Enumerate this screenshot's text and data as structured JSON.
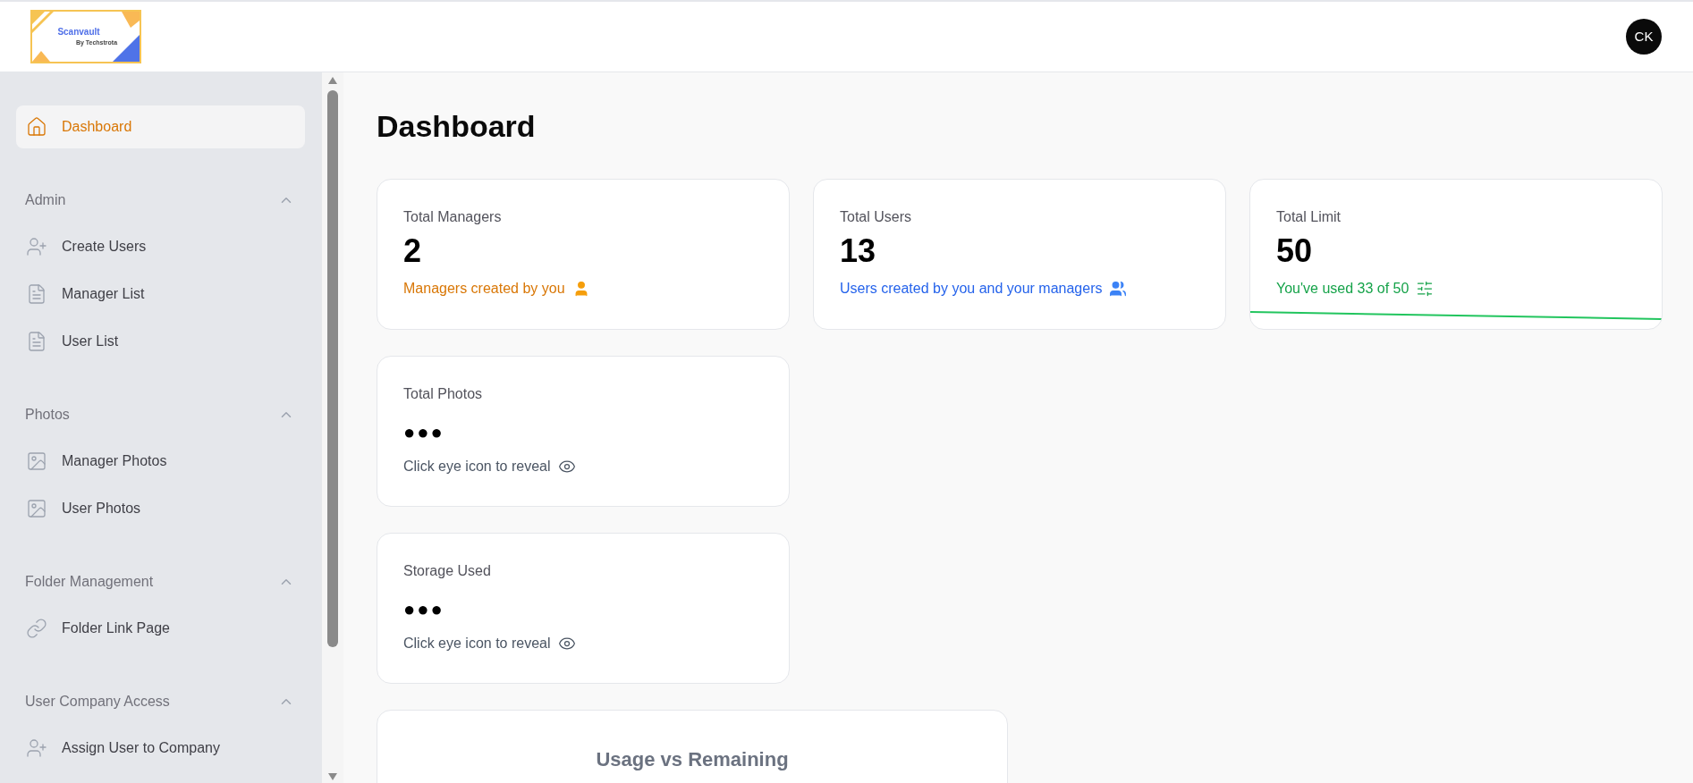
{
  "header": {
    "logo": {
      "title": "Scanvault",
      "subtitle": "By Techstrota"
    },
    "avatar": "CK"
  },
  "sidebar": {
    "top_item": {
      "label": "Dashboard",
      "selected": true
    },
    "sections": [
      {
        "title": "Admin",
        "expanded": true,
        "items": [
          {
            "label": "Create Users",
            "selected": false
          },
          {
            "label": "Manager List",
            "selected": false
          },
          {
            "label": "User List",
            "selected": false
          }
        ]
      },
      {
        "title": "Photos",
        "expanded": true,
        "items": [
          {
            "label": "Manager Photos",
            "selected": false
          },
          {
            "label": "User Photos",
            "selected": false
          }
        ]
      },
      {
        "title": "Folder Management",
        "expanded": true,
        "items": [
          {
            "label": "Folder Link Page",
            "selected": false
          }
        ]
      },
      {
        "title": "User Company Access",
        "expanded": true,
        "items": [
          {
            "label": "Assign User to Company",
            "selected": false
          }
        ]
      }
    ]
  },
  "page_title": "Dashboard",
  "stat_cards": [
    {
      "kind": "value",
      "label": "Total Managers",
      "value": "2",
      "note": "Managers created by you",
      "color": "#d97706"
    },
    {
      "kind": "value",
      "label": "Total Users",
      "value": "13",
      "note": "Users created by you and your managers",
      "color": "#2563eb"
    },
    {
      "kind": "limit",
      "label": "Total Limit",
      "value": "50",
      "note": "You've used 33 of 50",
      "color": "#16a34a"
    },
    {
      "kind": "hidden",
      "label": "Total Photos",
      "value": "●●●",
      "note": "Click eye icon to reveal",
      "color": "#4b5563"
    },
    {
      "kind": "hidden",
      "label": "Storage Used",
      "value": "●●●",
      "note": "Click eye icon to reveal",
      "color": "#4b5563"
    }
  ],
  "chart_card": {
    "title": "Usage vs Remaining"
  }
}
